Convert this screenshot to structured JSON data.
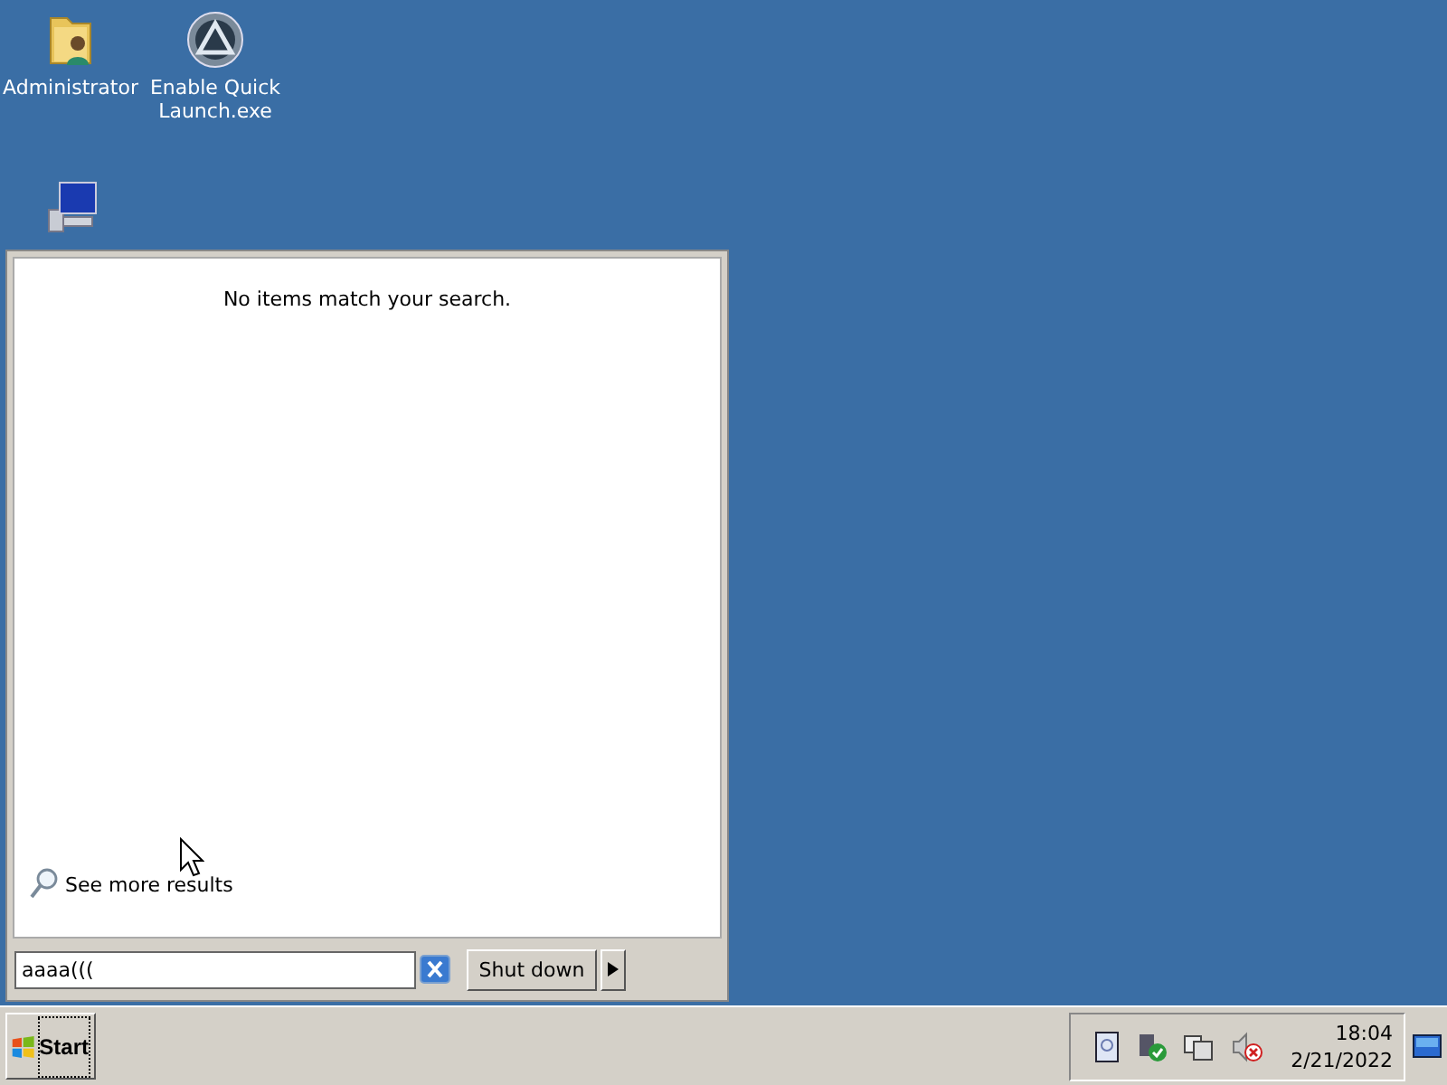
{
  "desktop_icons": [
    {
      "kind": "folder",
      "label": "Administrator"
    },
    {
      "kind": "app",
      "label": "Enable Quick Launch.exe"
    },
    {
      "kind": "computer"
    }
  ],
  "start_menu": {
    "message": "No items match your search.",
    "see_more": "See more results",
    "search": {
      "value": "aaaa((("
    },
    "shutdown": "Shut down"
  },
  "taskbar": {
    "start": "Start",
    "clock": {
      "time": "18:04",
      "date": "2/21/2022"
    }
  }
}
